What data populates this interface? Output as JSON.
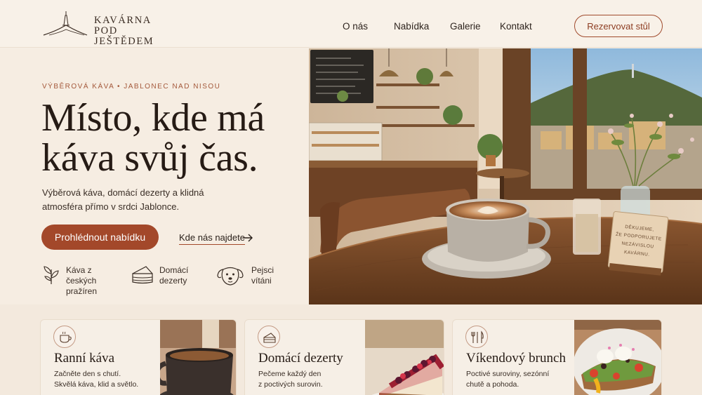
{
  "brand": {
    "line1": "KAVÁRNA",
    "line2": "POD JEŠTĚDEM",
    "logo_icon": "jested-tower-mountain-icon"
  },
  "nav": {
    "items": [
      {
        "label": "O nás"
      },
      {
        "label": "Nabídka"
      },
      {
        "label": "Galerie"
      },
      {
        "label": "Kontakt"
      }
    ],
    "cta_label": "Rezervovat stůl"
  },
  "hero": {
    "eyebrow": "VÝBĚROVÁ KÁVA • JABLONEC NAD NISOU",
    "headline_line1": "Místo, kde má",
    "headline_line2": "káva svůj čas.",
    "subtext": "Výběrová káva, domácí dezerty a klidná atmosféra přímo v srdci Jablonce.",
    "primary_button": "Prohlédnout nabídku",
    "secondary_link": "Kde nás najdete",
    "features": [
      {
        "icon": "coffee-plant-icon",
        "label": "Káva z českých pražíren"
      },
      {
        "icon": "cake-slice-icon",
        "label": "Domácí dezerty"
      },
      {
        "icon": "dog-icon",
        "label": "Pejsci vítáni"
      }
    ],
    "photo_sign_text": "DĚKUJEME, ŽE PODPORUJETE NEZÁVISLOU KAVÁRNU."
  },
  "cards": [
    {
      "icon": "coffee-cup-icon",
      "title": "Ranní káva",
      "description": "Začněte den s chutí.\nSkvělá káva, klid a světlo."
    },
    {
      "icon": "cake-icon",
      "title": "Domácí dezerty",
      "description": "Pečeme každý den\nz poctivých surovin."
    },
    {
      "icon": "cutlery-icon",
      "title": "Víkendový brunch",
      "description": "Poctivé suroviny, sezónní\nchutě a pohoda."
    }
  ],
  "colors": {
    "accent": "#a3482a",
    "background": "#f6eee4",
    "text": "#261b15"
  }
}
